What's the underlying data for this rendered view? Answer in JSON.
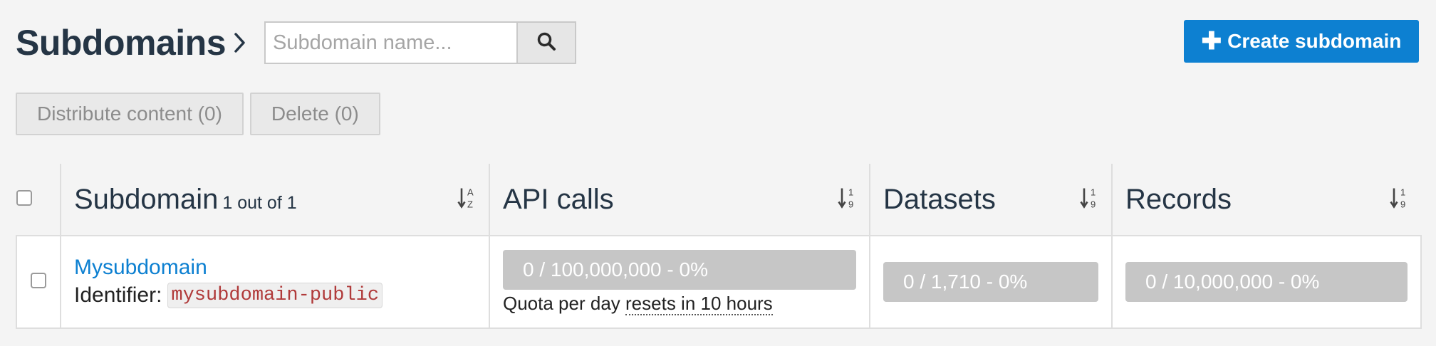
{
  "header": {
    "title": "Subdomains",
    "search_placeholder": "Subdomain name..."
  },
  "actions": {
    "create_label": "Create subdomain",
    "distribute_label": "Distribute content (0)",
    "delete_label": "Delete (0)"
  },
  "table": {
    "columns": {
      "subdomain": "Subdomain",
      "subdomain_count": "1 out of 1",
      "api_calls": "API calls",
      "datasets": "Datasets",
      "records": "Records"
    },
    "rows": [
      {
        "name": "Mysubdomain",
        "identifier_label": "Identifier:",
        "identifier": "mysubdomain-public",
        "api_calls": "0 / 100,000,000 - 0%",
        "api_calls_fraction": 0,
        "quota_note_prefix": "Quota per day",
        "quota_note_reset": "resets in 10 hours",
        "datasets": "0 / 1,710 - 0%",
        "datasets_fraction": 0,
        "records": "0 / 10,000,000 - 0%",
        "records_fraction": 0
      }
    ]
  },
  "colors": {
    "primary": "#0d80d1",
    "title": "#253545",
    "bar_empty": "#c6c6c6",
    "identifier": "#b03a3a"
  },
  "icons": [
    "chevron-right-icon",
    "search-icon",
    "plus-icon",
    "sort-alpha-icon",
    "sort-numeric-icon"
  ]
}
